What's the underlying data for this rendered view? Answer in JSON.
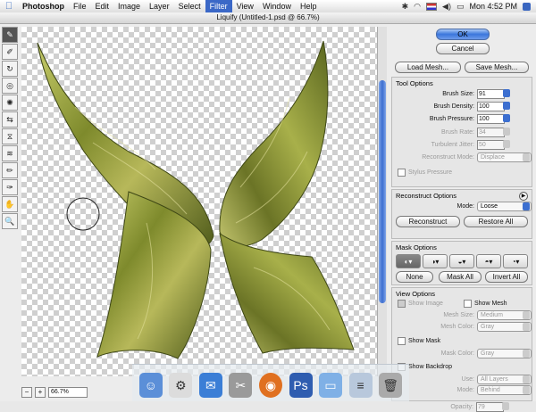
{
  "menubar": {
    "apple": "",
    "app": "Photoshop",
    "items": [
      "File",
      "Edit",
      "Image",
      "Layer",
      "Select",
      "Filter",
      "View",
      "Window",
      "Help"
    ],
    "active_item": "Filter",
    "clock": "Mon 4:52 PM"
  },
  "window": {
    "title": "Liquify (Untitled-1.psd @ 66.7%)"
  },
  "zoom": {
    "value": "66.7%",
    "minus": "−",
    "plus": "+"
  },
  "buttons": {
    "ok": "OK",
    "cancel": "Cancel",
    "load_mesh": "Load Mesh...",
    "save_mesh": "Save Mesh..."
  },
  "tool_options": {
    "title": "Tool Options",
    "brush_size_label": "Brush Size:",
    "brush_size": "91",
    "brush_density_label": "Brush Density:",
    "brush_density": "100",
    "brush_pressure_label": "Brush Pressure:",
    "brush_pressure": "100",
    "brush_rate_label": "Brush Rate:",
    "brush_rate": "34",
    "turbulent_jitter_label": "Turbulent Jitter:",
    "turbulent_jitter": "50",
    "reconstruct_mode_label": "Reconstruct Mode:",
    "reconstruct_mode": "Displace",
    "stylus_pressure": "Stylus Pressure"
  },
  "reconstruct_options": {
    "title": "Reconstruct Options",
    "mode_label": "Mode:",
    "mode": "Loose",
    "reconstruct_button": "Reconstruct",
    "restore_all_button": "Restore All"
  },
  "mask_options": {
    "title": "Mask Options",
    "none_button": "None",
    "mask_all_button": "Mask All",
    "invert_all_button": "Invert All"
  },
  "view_options": {
    "title": "View Options",
    "show_image": "Show Image",
    "show_mesh": "Show Mesh",
    "mesh_size_label": "Mesh Size:",
    "mesh_size": "Medium",
    "mesh_color_label": "Mesh Color:",
    "mesh_color": "Gray",
    "show_mask": "Show Mask",
    "mask_color_label": "Mask Color:",
    "mask_color": "Gray",
    "show_backdrop": "Show Backdrop",
    "use_label": "Use:",
    "use": "All Layers",
    "mode_label": "Mode:",
    "mode": "Behind",
    "opacity_label": "Opacity:",
    "opacity": "79"
  },
  "colors": {
    "accent": "#3b68c7",
    "wing_dark": "#4f5a1c",
    "wing_light": "#b8c05a"
  }
}
